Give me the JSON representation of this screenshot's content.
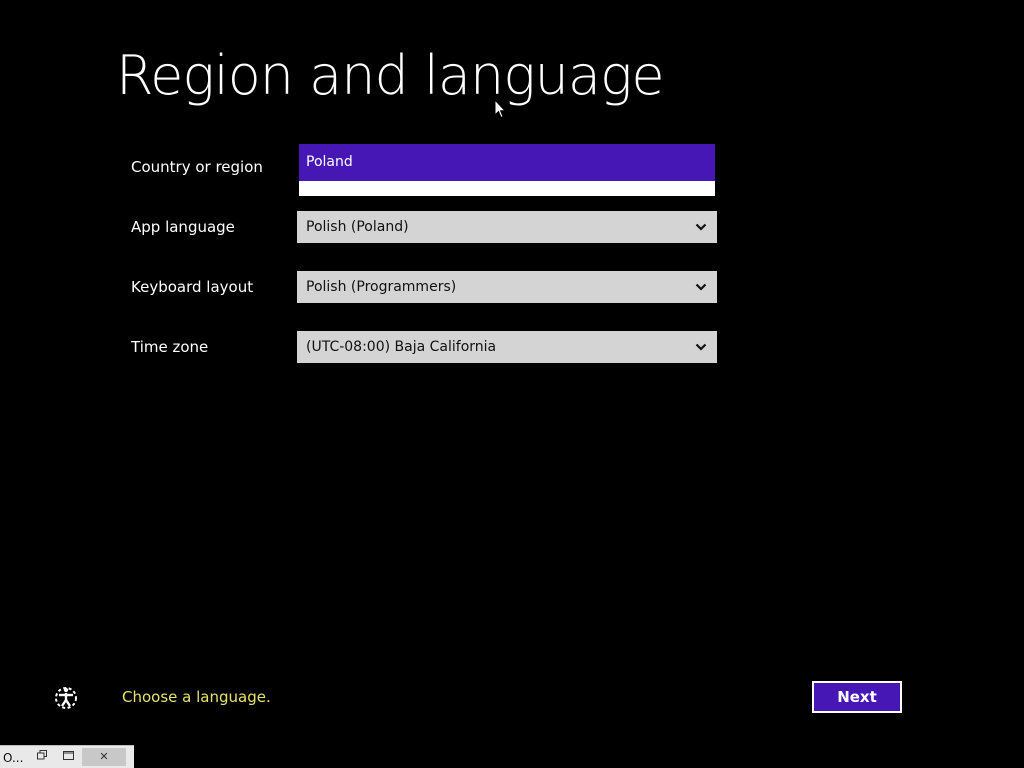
{
  "title": "Region and language",
  "fields": {
    "country": {
      "label": "Country or region",
      "value": "Poland"
    },
    "app_language": {
      "label": "App language",
      "value": "Polish (Poland)"
    },
    "keyboard": {
      "label": "Keyboard layout",
      "value": "Polish (Programmers)"
    },
    "timezone": {
      "label": "Time zone",
      "value": "(UTC-08:00) Baja California"
    }
  },
  "footer": {
    "hint": "Choose a language.",
    "next_label": "Next"
  },
  "taskbar": {
    "title": "O...",
    "close_glyph": "✕"
  },
  "colors": {
    "accent": "#4617b4",
    "hint": "#e8e26a",
    "background": "#000000",
    "field": "#d4d4d4"
  },
  "icons": {
    "chevron": "chevron-down-icon",
    "ease_of_access": "ease-of-access-icon",
    "cursor": "mouse-pointer-icon",
    "restore": "restore-icon",
    "maximize": "maximize-icon",
    "close": "close-icon"
  }
}
